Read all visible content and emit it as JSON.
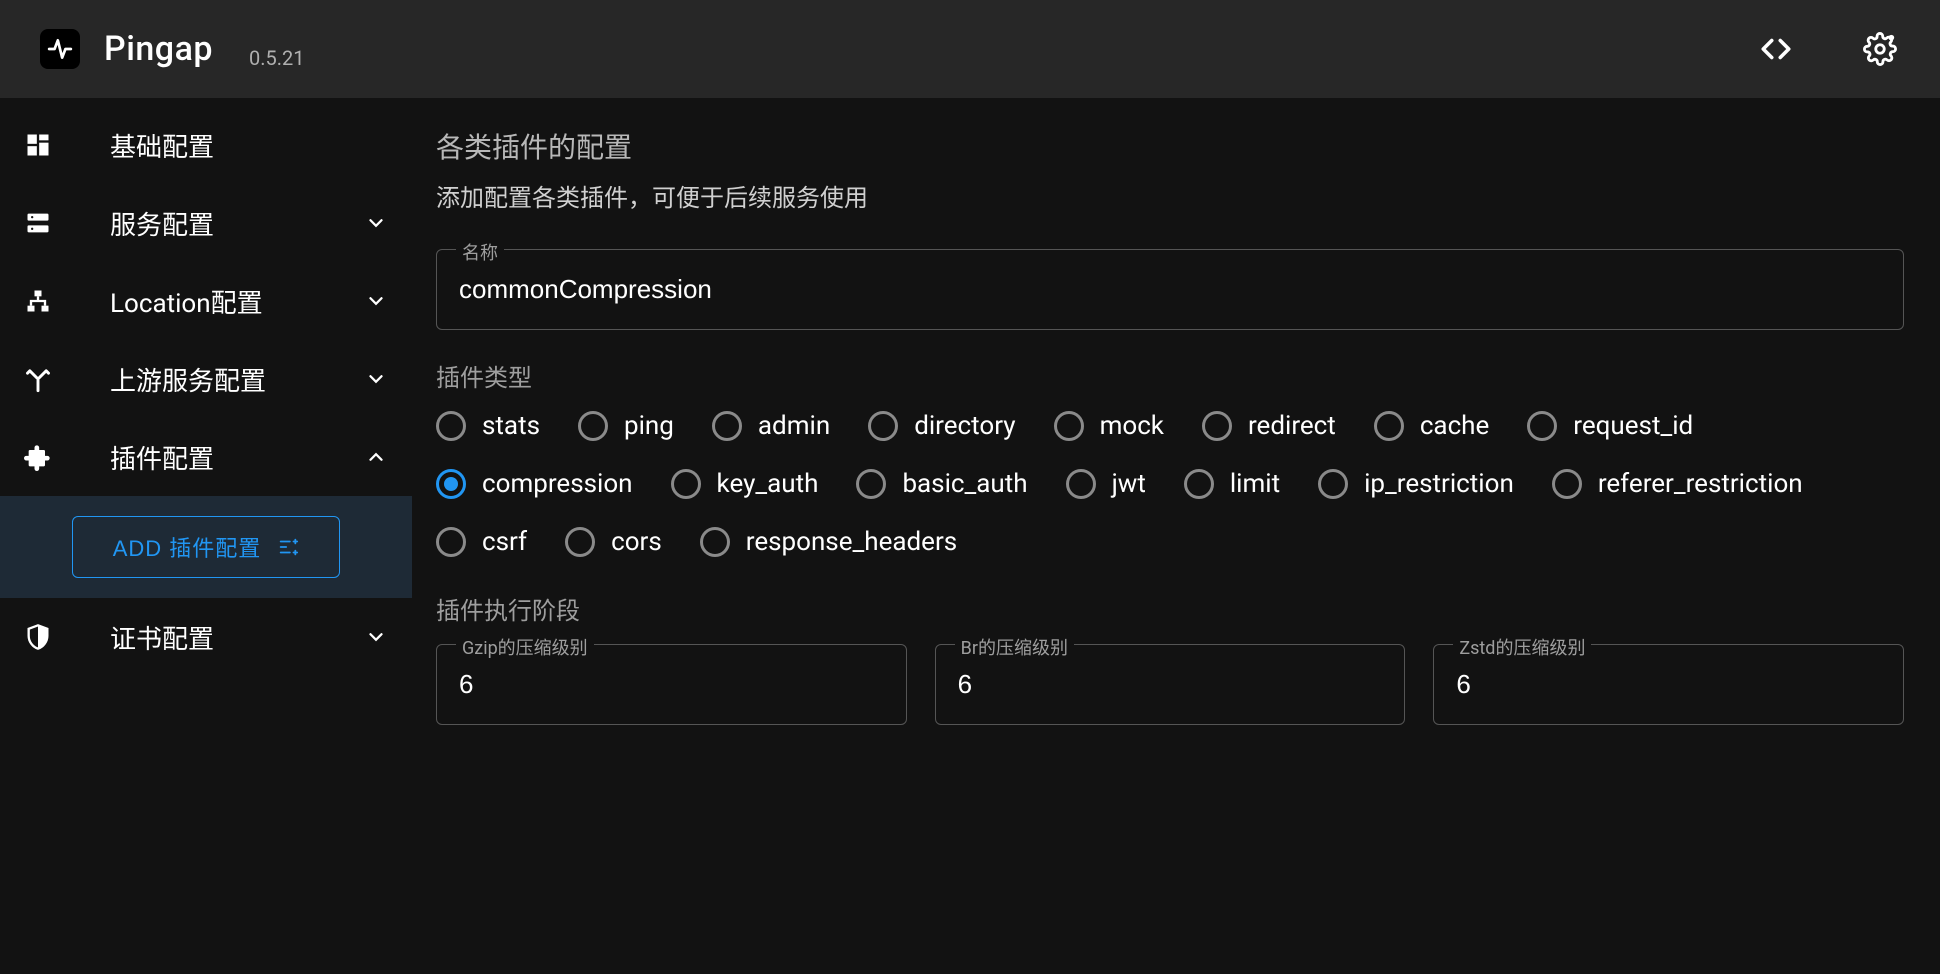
{
  "header": {
    "title": "Pingap",
    "version": "0.5.21"
  },
  "sidebar": {
    "items": [
      {
        "label": "基础配置",
        "icon": "dashboard-icon",
        "expandable": false
      },
      {
        "label": "服务配置",
        "icon": "server-icon",
        "expandable": true,
        "chev": "down"
      },
      {
        "label": "Location配置",
        "icon": "sitemap-icon",
        "expandable": true,
        "chev": "down"
      },
      {
        "label": "上游服务配置",
        "icon": "fork-icon",
        "expandable": true,
        "chev": "down"
      },
      {
        "label": "插件配置",
        "icon": "puzzle-icon",
        "expandable": true,
        "chev": "up"
      },
      {
        "label": "证书配置",
        "icon": "shield-icon",
        "expandable": true,
        "chev": "down"
      }
    ],
    "add_button_label": "ADD 插件配置"
  },
  "main": {
    "title": "各类插件的配置",
    "subtitle": "添加配置各类插件，可便于后续服务使用",
    "name_label": "名称",
    "name_value": "commonCompression",
    "plugin_type_label": "插件类型",
    "plugin_types": [
      "stats",
      "ping",
      "admin",
      "directory",
      "mock",
      "redirect",
      "cache",
      "request_id",
      "compression",
      "key_auth",
      "basic_auth",
      "jwt",
      "limit",
      "ip_restriction",
      "referer_restriction",
      "csrf",
      "cors",
      "response_headers"
    ],
    "plugin_type_selected": "compression",
    "exec_stage_label": "插件执行阶段",
    "gzip_label": "Gzip的压缩级别",
    "gzip_value": "6",
    "br_label": "Br的压缩级别",
    "br_value": "6",
    "zstd_label": "Zstd的压缩级别",
    "zstd_value": "6"
  }
}
